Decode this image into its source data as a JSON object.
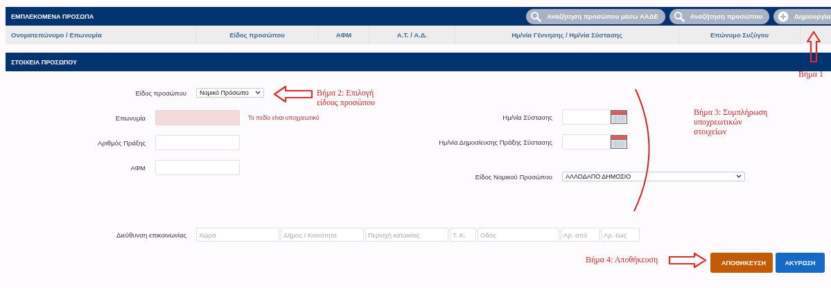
{
  "involved_persons": {
    "title": "ΕΜΠΛΕΚΟΜΕΝΑ ΠΡΟΣΩΠΑ",
    "actions": [
      {
        "label": "Αναζήτηση προσώπου μέσω ΑΑΔΕ"
      },
      {
        "label": "Αναζήτηση προσώπου"
      },
      {
        "label": "Δημιουργία"
      }
    ],
    "columns": [
      "Ονοματεπώνυμο / Επωνυμία",
      "Είδος προσώπου",
      "ΑΦΜ",
      "Α.Τ. / Α.Δ.",
      "Ημ/νία Γέννησης / Ημ/νία Σύστασης",
      "Επώνυμο Συζύγου"
    ]
  },
  "person_details": {
    "title": "ΣΤΟΙΧΕΙΑ ΠΡΟΣΩΠΟΥ",
    "left_fields": [
      {
        "kind": "select",
        "label": "Είδος προσώπου",
        "value": "Νομικό Πρόσωπο"
      },
      {
        "kind": "text",
        "label": "Επωνυμία",
        "invalid": true,
        "error": "Το πεδίο είναι υποχρεωτικό"
      },
      {
        "kind": "text",
        "label": "Αριθμός Πράξης",
        "invalid": false
      },
      {
        "kind": "text",
        "label": "ΑΦΜ",
        "invalid": false
      }
    ],
    "right_fields": [
      {
        "kind": "date",
        "label": "Ημ/νία Σύστασης"
      },
      {
        "kind": "date",
        "label": "Ημ/νία Δημοσίευσης Πράξης Σύστασης"
      },
      {
        "kind": "select",
        "label": "Είδος Νομικού Προσώπου",
        "value": "ΑΛΛΟΔΑΠΟ ΔΗΜΟΣΙΟ"
      }
    ],
    "address": {
      "label": "Διεύθυνση επικοινωνίας",
      "placeholders": [
        "Χώρα",
        "Δήμος / Κοινότητα",
        "Περιοχή κατοικίας",
        "Τ. Κ.",
        "Οδός",
        "Αρ. από",
        "Αρ. έως"
      ]
    },
    "buttons": [
      {
        "label": "ΑΠΟΘΗΚΕΥΣΗ",
        "kind": "primary"
      },
      {
        "label": "ΑΚΥΡΩΣΗ",
        "kind": "secondary"
      }
    ]
  },
  "annotations": [
    {
      "text": "Βήμα 1"
    },
    {
      "text": "Βήμα 2: Επιλογή είδους προσώπου"
    },
    {
      "text": "Βήμα 3: Συμπλήρωση υποχρεωτικών στοιχείων"
    },
    {
      "text": "Βήμα 4: Αποθήκευση"
    }
  ]
}
